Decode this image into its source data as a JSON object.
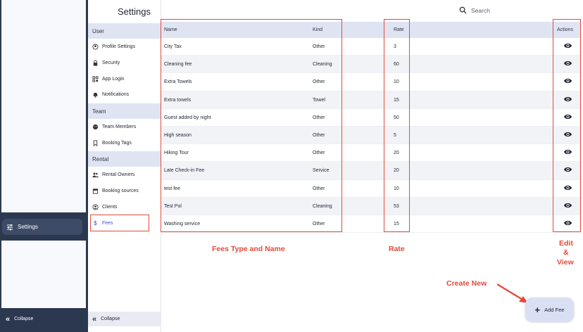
{
  "rail": {
    "active_label": "Settings",
    "collapse_label": "Collapse"
  },
  "page": {
    "title": "Settings",
    "search_label": "Search"
  },
  "submenu": {
    "sections": [
      {
        "header": "User",
        "items": [
          {
            "label": "Profile Settings",
            "icon": "account-circle-icon"
          },
          {
            "label": "Security",
            "icon": "lock-icon"
          },
          {
            "label": "App Login",
            "icon": "qr-code-icon"
          },
          {
            "label": "Notifications",
            "icon": "bell-icon"
          }
        ]
      },
      {
        "header": "Team",
        "items": [
          {
            "label": "Team Members",
            "icon": "face-icon"
          },
          {
            "label": "Booking Tags",
            "icon": "bookmark-icon"
          }
        ]
      },
      {
        "header": "Rental",
        "items": [
          {
            "label": "Rental Owners",
            "icon": "people-icon"
          },
          {
            "label": "Booking sources",
            "icon": "store-icon"
          },
          {
            "label": "Clients",
            "icon": "user-circle-icon"
          },
          {
            "label": "Fees",
            "icon": "dollar-icon"
          }
        ]
      }
    ],
    "collapse_label": "Collapse"
  },
  "table": {
    "headers": {
      "name": "Name",
      "kind": "Kind",
      "rate": "Rate",
      "actions": "Actions"
    },
    "rows": [
      {
        "name": "City Tax",
        "kind": "Other",
        "rate": "3"
      },
      {
        "name": "Cleaning fee",
        "kind": "Cleaning",
        "rate": "60"
      },
      {
        "name": "Extra Towels",
        "kind": "Other",
        "rate": "10"
      },
      {
        "name": "Extra towels",
        "kind": "Towel",
        "rate": "15"
      },
      {
        "name": "Guest added by night",
        "kind": "Other",
        "rate": "50"
      },
      {
        "name": "High season",
        "kind": "Other",
        "rate": "5"
      },
      {
        "name": "Hiking Tour",
        "kind": "Other",
        "rate": "20"
      },
      {
        "name": "Late Check-in Fee",
        "kind": "Service",
        "rate": "20"
      },
      {
        "name": "test fee",
        "kind": "Other",
        "rate": "10"
      },
      {
        "name": "Test Pol",
        "kind": "Cleaning",
        "rate": "53"
      },
      {
        "name": "Washing service",
        "kind": "Other",
        "rate": "15"
      }
    ]
  },
  "annotations": {
    "fees_type_name": "Fees Type and Name",
    "rate": "Rate",
    "edit_view_line1": "Edit",
    "edit_view_line2": "&",
    "edit_view_line3": "View",
    "create_new": "Create New"
  },
  "add_button": {
    "label": "Add Fee"
  },
  "colors": {
    "accent": "#3c4fd6",
    "annotation": "#e34a3a",
    "rail": "#2b3850",
    "header_bg": "#dfe4f3"
  }
}
